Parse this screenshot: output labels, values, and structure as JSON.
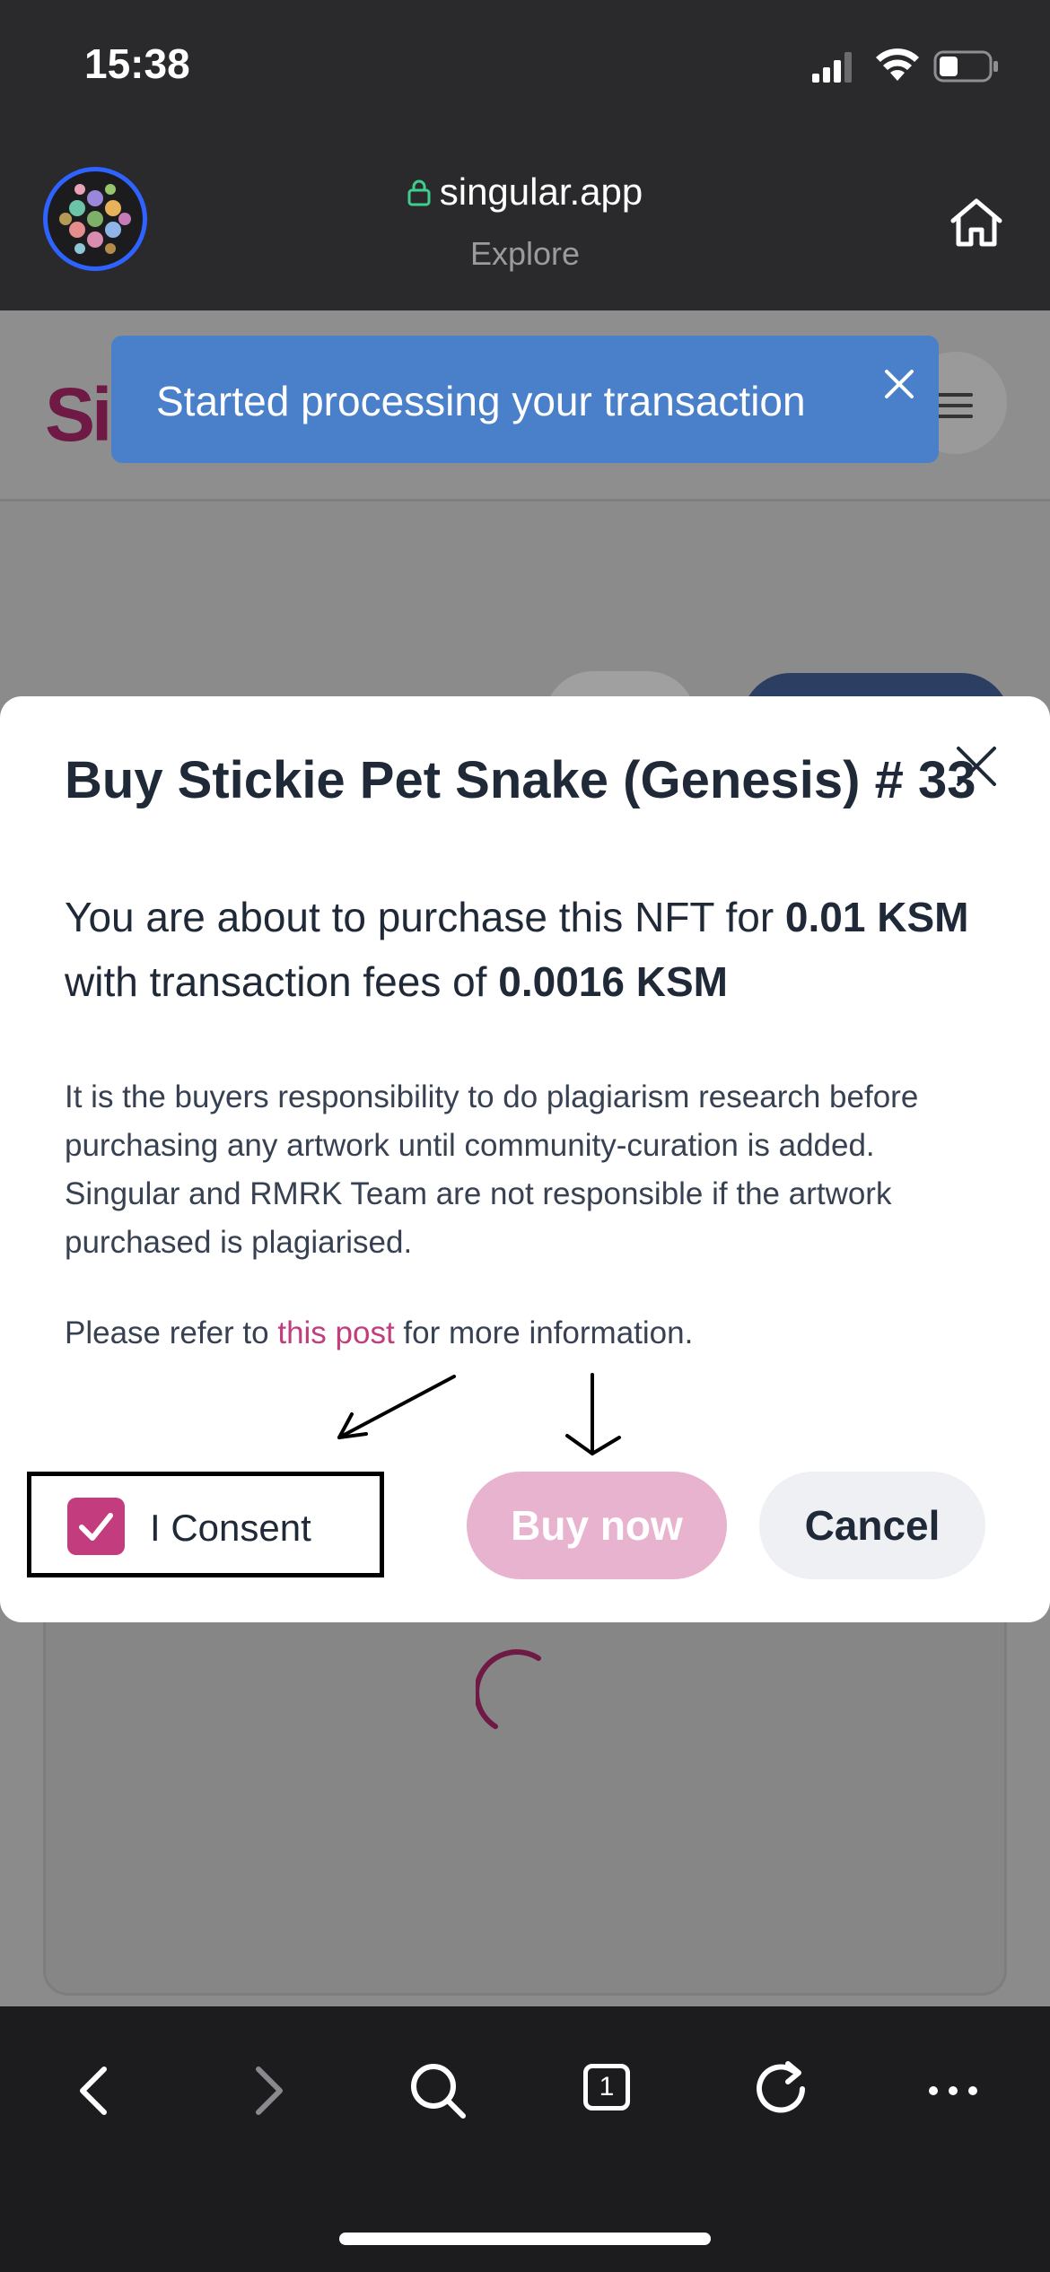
{
  "status_bar": {
    "time": "15:38"
  },
  "browser": {
    "domain": "singular.app",
    "subtitle": "Explore"
  },
  "site": {
    "logo_text": "Si"
  },
  "toast": {
    "message": "Started processing your transaction"
  },
  "modal": {
    "title": "Buy Stickie Pet Snake (Genesis) # 33",
    "price_line": {
      "prefix": "You are about to purchase this NFT for ",
      "price": "0.01 KSM",
      "middle": " with transaction fees of ",
      "fee": "0.0016 KSM"
    },
    "disclaimer": "It is the buyers responsibility to do plagiarism research before purchasing any artwork until community-curation is added. Singular and RMRK Team are not responsible if the artwork purchased is plagiarised.",
    "refer": {
      "prefix": "Please refer to ",
      "link": "this post",
      "suffix": " for more information."
    },
    "consent_label": "I Consent",
    "consent_checked": true,
    "buy_label": "Buy now",
    "cancel_label": "Cancel"
  },
  "bottom_nav": {
    "tab_count": "1"
  },
  "colors": {
    "brand": "#c23c7e",
    "toast": "#4a80c9",
    "buy_disabled": "#e8b3cf"
  }
}
